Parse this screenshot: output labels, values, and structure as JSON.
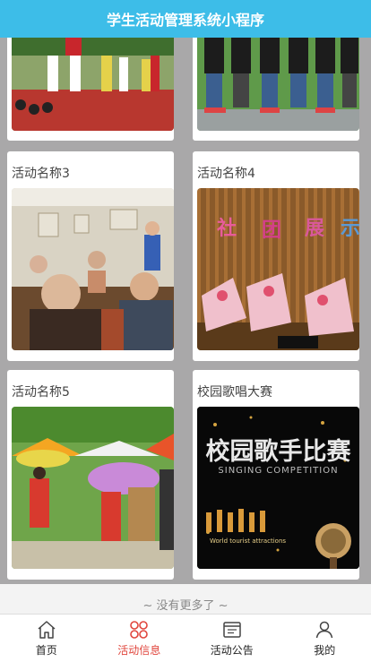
{
  "app": {
    "title": "学生活动管理系统小程序"
  },
  "activities": [
    {
      "title": "活动名称3"
    },
    {
      "title": "活动名称4"
    },
    {
      "title": "活动名称5"
    },
    {
      "title": "校园歌唱大赛",
      "poster": {
        "headline": "校园歌手比赛",
        "subtitle": "SINGING  COMPETITION",
        "tagline": "World tourist attractions"
      }
    }
  ],
  "list_end_text": "~ 没有更多了 ~",
  "tabbar": {
    "items": [
      {
        "label": "首页",
        "icon": "home-icon"
      },
      {
        "label": "活动信息",
        "icon": "activity-icon"
      },
      {
        "label": "活动公告",
        "icon": "notice-icon"
      },
      {
        "label": "我的",
        "icon": "profile-icon"
      }
    ],
    "active_index": 1,
    "active_color": "#e0463d"
  },
  "colors": {
    "header": "#3dbde8",
    "grid_bg": "#a9a8a9"
  }
}
